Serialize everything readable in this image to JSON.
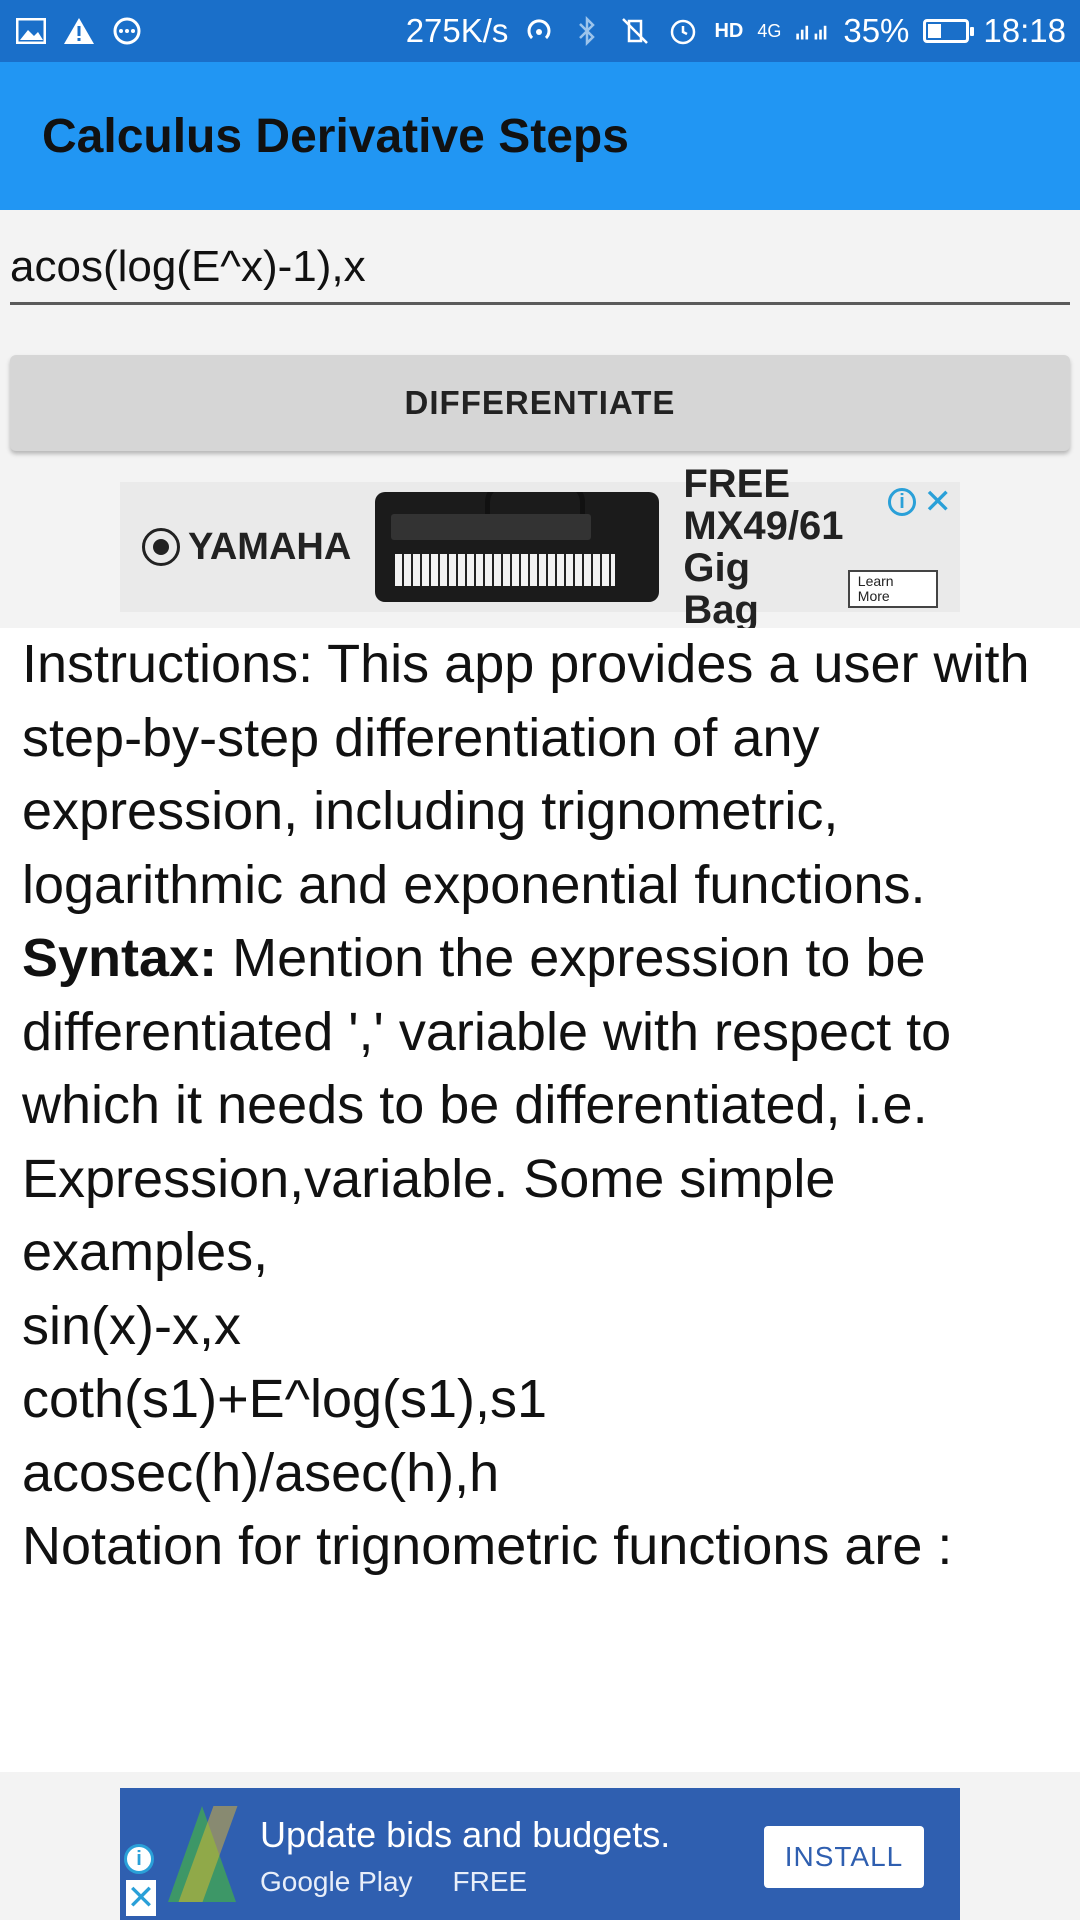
{
  "status_bar": {
    "net_speed": "275K/s",
    "network_type": "4G",
    "hd": "HD",
    "battery_percent": "35%",
    "battery_level": 0.35,
    "time": "18:18",
    "icons": [
      "image-icon",
      "warning-icon",
      "more-icon",
      "hotspot-icon",
      "bluetooth-icon",
      "vibrate-icon",
      "alarm-icon",
      "signal-icon",
      "battery-icon"
    ]
  },
  "app_bar": {
    "title": "Calculus Derivative Steps"
  },
  "input": {
    "value": "acos(log(E^x)-1),x"
  },
  "button": {
    "label": "DIFFERENTIATE"
  },
  "ad_top": {
    "brand": "YAMAHA",
    "headline": "FREE MX49/61",
    "subline": "Gig Bag",
    "cta": "Learn More"
  },
  "instructions": {
    "intro": "Instructions: This app provides a user with step-by-step differentiation of any expression, including trignometric, logarithmic and exponential functions.",
    "syntax_label": "Syntax:",
    "syntax_text": " Mention the expression to be differentiated ',' variable with respect to which it needs to be differentiated, i.e. Expression,variable. Some simple examples,",
    "examples": [
      "sin(x)-x,x",
      "coth(s1)+E^log(s1),s1",
      "acosec(h)/asec(h),h"
    ],
    "notation": "Notation for trignometric functions are :"
  },
  "ad_bottom": {
    "title": "Update bids and budgets.",
    "store": "Google Play",
    "price": "FREE",
    "install": "INSTALL"
  },
  "colors": {
    "status_bar": "#1a6fc9",
    "app_bar": "#2196f3",
    "button": "#d6d6d6",
    "ad_bottom": "#2f5fb0"
  }
}
